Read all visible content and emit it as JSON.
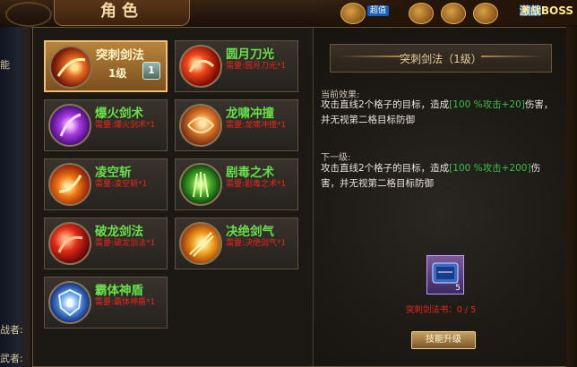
{
  "window": {
    "title": "角色",
    "top_tags": [
      "超值",
      "超值"
    ],
    "top_right_text": "激战BOSS"
  },
  "side_labels": [
    "能",
    "战者:",
    "武者:"
  ],
  "skills": [
    {
      "name": "突刺剑法",
      "level": "1级",
      "badge": "1",
      "icon": "sword-thrust-icon",
      "requirement": ""
    },
    {
      "name": "圆月刀光",
      "requirement": "需要:圆月刀光*1",
      "icon": "crescent-blade-icon"
    },
    {
      "name": "爆火剑术",
      "requirement": "需要:爆火剑术*1",
      "icon": "blaze-sword-icon"
    },
    {
      "name": "龙啸冲撞",
      "requirement": "需要:龙啸冲撞*1",
      "icon": "dragon-charge-icon"
    },
    {
      "name": "凌空斩",
      "requirement": "需要:凌空斩*1",
      "icon": "sky-slash-icon"
    },
    {
      "name": "剧毒之术",
      "requirement": "需要:剧毒之术*1",
      "icon": "poison-icon"
    },
    {
      "name": "破龙剑法",
      "requirement": "需要:破龙剑法*1",
      "icon": "dragon-break-icon"
    },
    {
      "name": "决绝剑气",
      "requirement": "需要:决绝剑气*1",
      "icon": "sword-qi-icon"
    },
    {
      "name": "霸体神盾",
      "requirement": "需要:霸体神盾*1",
      "icon": "shield-icon"
    }
  ],
  "detail": {
    "title": "突刺剑法（1级）",
    "current_label": "当前效果:",
    "current_text_a": "攻击直线2个格子的目标，造成",
    "current_text_hl": "[100 %攻击+20]",
    "current_text_b": "伤害，并无视第二格目标防御",
    "next_label": "下一级:",
    "next_text_a": "攻击直线2个格子的目标，造成",
    "next_text_hl": "[100 %攻击+200]",
    "next_text_b": "伤害，并无视第二格目标防御",
    "scroll_count": "5",
    "scroll_requirement": "突刺剑法书：0 / 5",
    "upgrade_label": "技能升级"
  }
}
